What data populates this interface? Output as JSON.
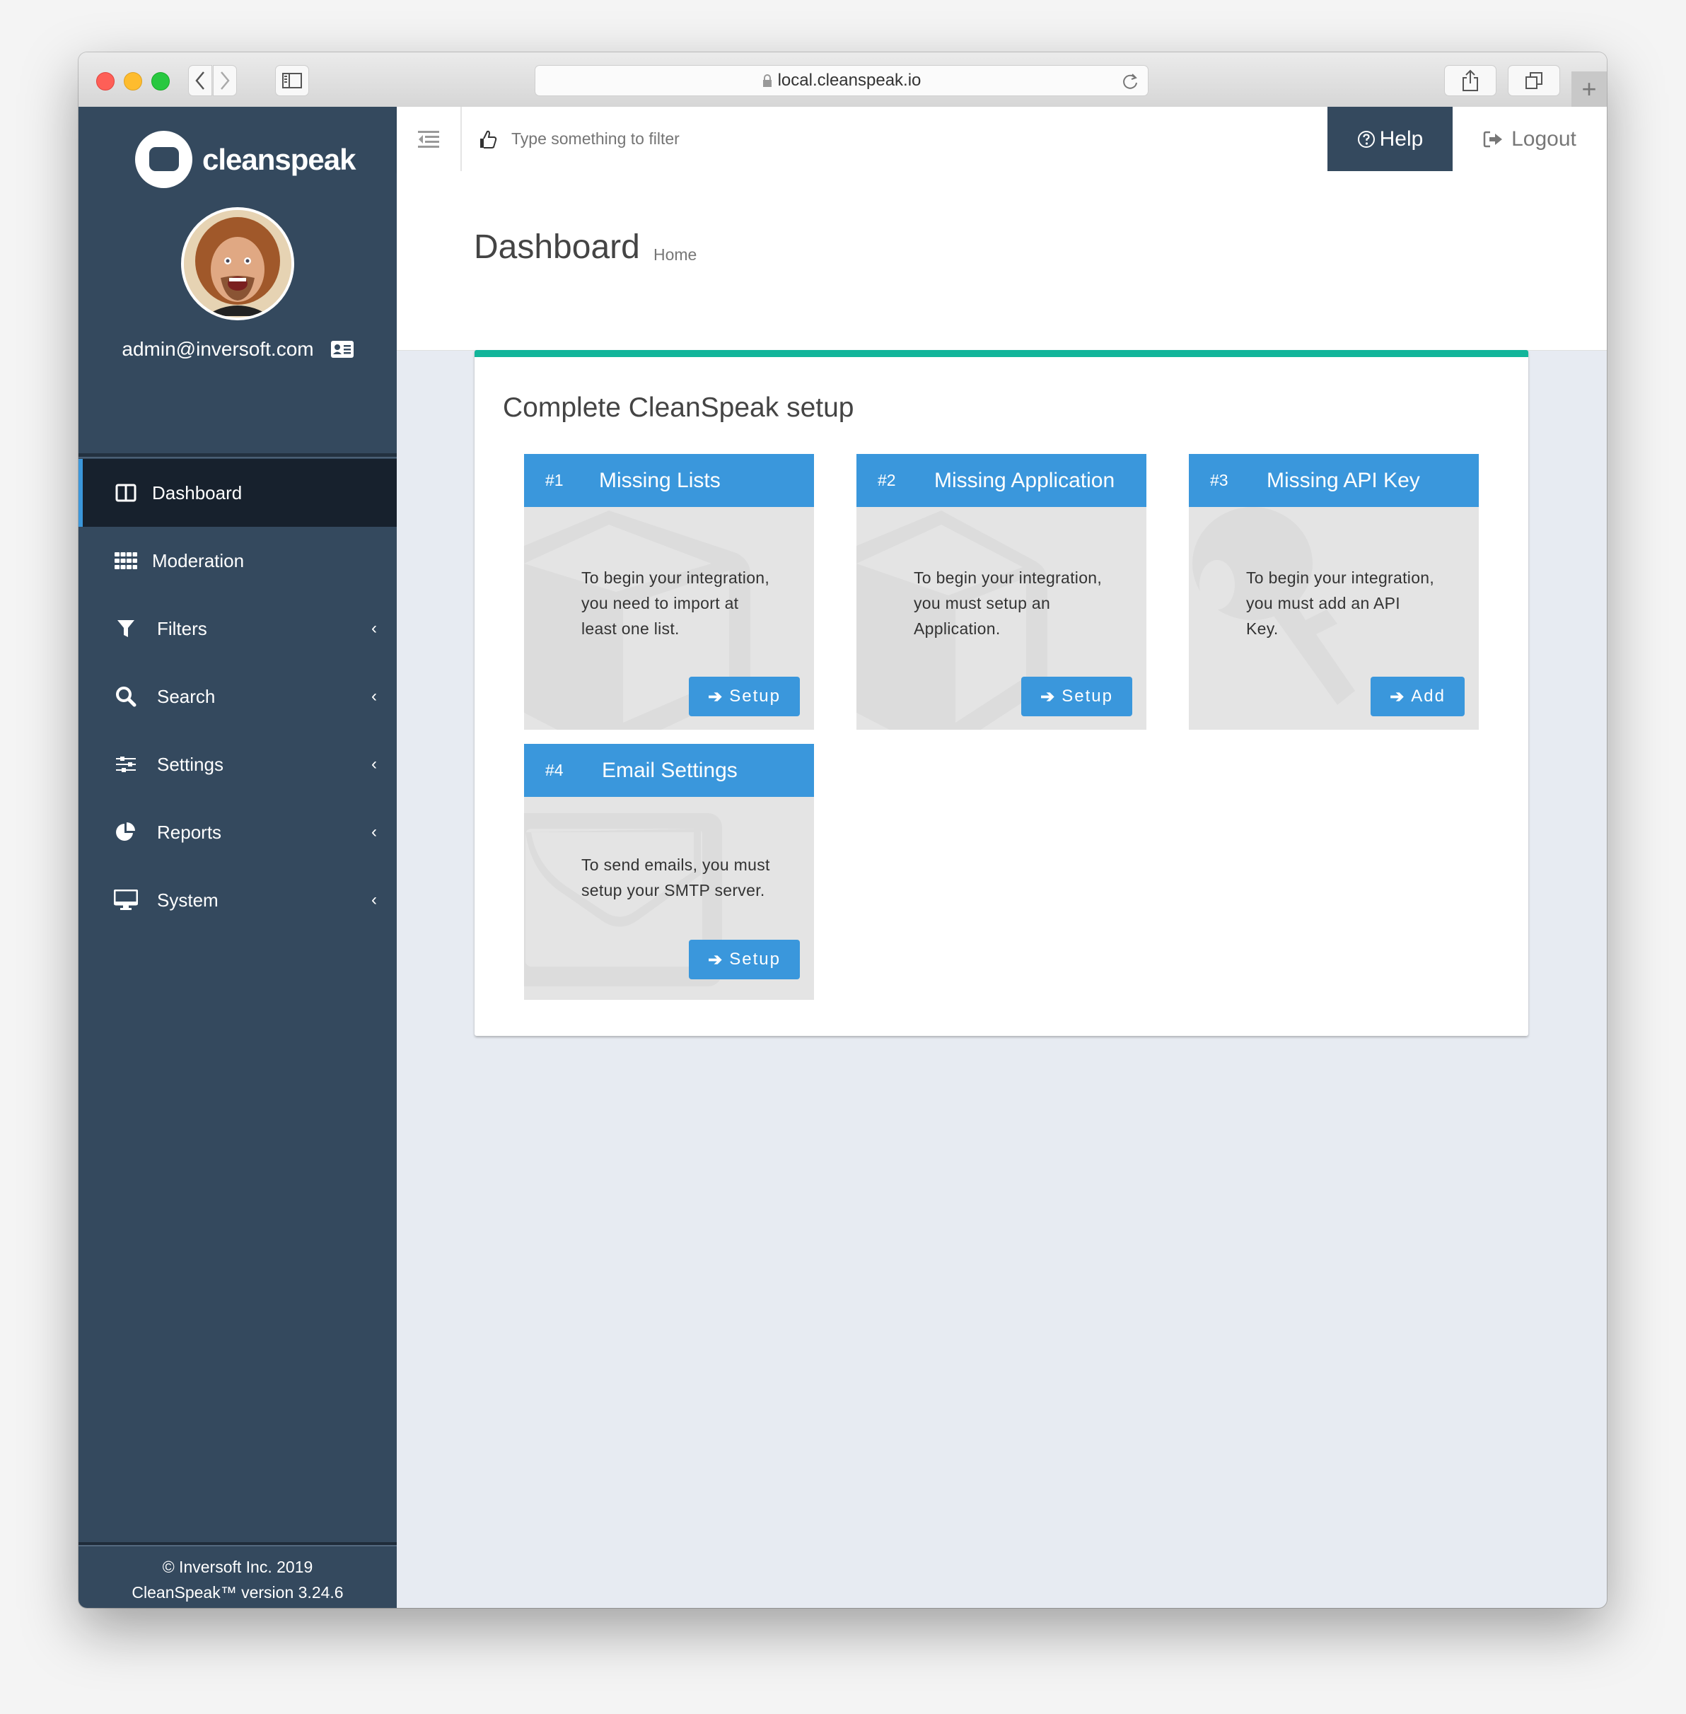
{
  "browser": {
    "url": "local.cleanspeak.io",
    "new_tab_label": "+"
  },
  "sidebar": {
    "brand": "cleanspeak",
    "user_email": "admin@inversoft.com",
    "items": [
      {
        "label": "Dashboard",
        "icon": "columns-icon",
        "active": true,
        "expandable": false
      },
      {
        "label": "Moderation",
        "icon": "grid-icon",
        "active": false,
        "expandable": false
      },
      {
        "label": "Filters",
        "icon": "filter-icon",
        "active": false,
        "expandable": true
      },
      {
        "label": "Search",
        "icon": "search-icon",
        "active": false,
        "expandable": true
      },
      {
        "label": "Settings",
        "icon": "sliders-icon",
        "active": false,
        "expandable": true
      },
      {
        "label": "Reports",
        "icon": "pie-chart-icon",
        "active": false,
        "expandable": true
      },
      {
        "label": "System",
        "icon": "desktop-icon",
        "active": false,
        "expandable": true
      }
    ],
    "chevron": "‹",
    "footer_copyright": "© Inversoft Inc. 2019",
    "footer_version": "CleanSpeak™ version 3.24.6"
  },
  "topnav": {
    "filter_placeholder": "Type something to filter",
    "filter_value": "",
    "help_label": "Help",
    "logout_label": "Logout"
  },
  "page": {
    "title": "Dashboard",
    "breadcrumb": "Home"
  },
  "setup": {
    "title": "Complete CleanSpeak setup",
    "accent_color": "#12b59a",
    "tile_color": "#3a97dc",
    "tiles": [
      {
        "number": "#1",
        "title": "Missing Lists",
        "text": "To begin your integration, you need to import at least one list.",
        "button": "Setup",
        "bg_icon": "cube-icon"
      },
      {
        "number": "#2",
        "title": "Missing Application",
        "text": "To begin your integration, you must setup an Application.",
        "button": "Setup",
        "bg_icon": "cube-icon"
      },
      {
        "number": "#3",
        "title": "Missing API Key",
        "text": "To begin your integration, you must add an API Key.",
        "button": "Add",
        "bg_icon": "key-icon"
      },
      {
        "number": "#4",
        "title": "Email Settings",
        "text": "To send emails, you must setup your SMTP server.",
        "button": "Setup",
        "bg_icon": "envelope-icon"
      }
    ]
  }
}
